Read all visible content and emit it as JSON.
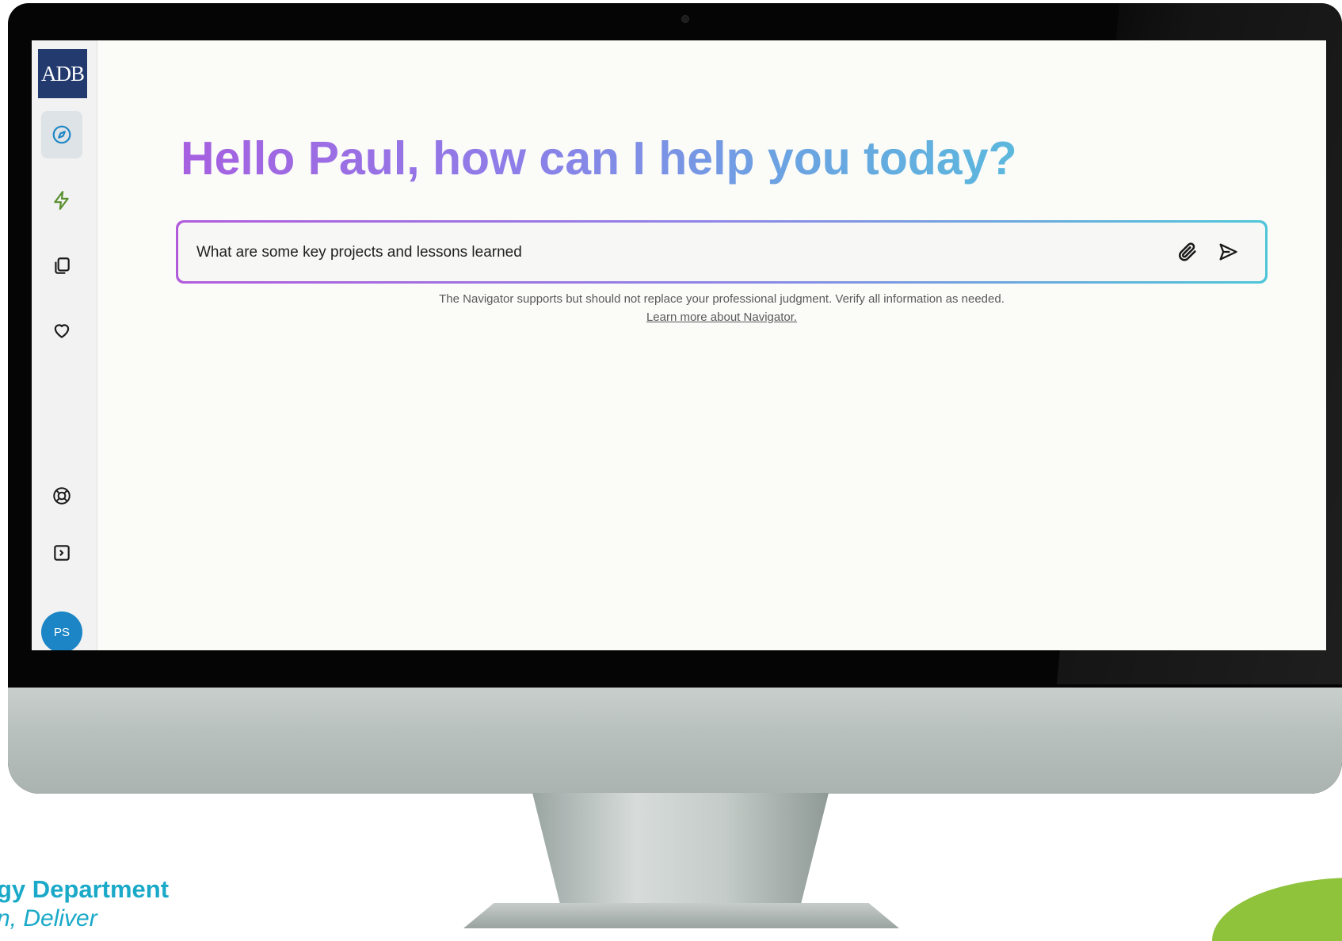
{
  "sidebar": {
    "logo": "ADB",
    "items": [
      {
        "name": "compass",
        "active": true
      },
      {
        "name": "lightning"
      },
      {
        "name": "documents"
      },
      {
        "name": "heart"
      },
      {
        "name": "help"
      },
      {
        "name": "expand-panel"
      }
    ],
    "avatar": "PS"
  },
  "main": {
    "greeting": "Hello Paul, how can I help you today?",
    "input": {
      "value": "What are some key projects and lessons learned"
    },
    "disclaimer": "The Navigator supports but should not replace your professional judgment. Verify all information as needed.",
    "learn_more": "Learn more about Navigator."
  },
  "footer": {
    "brand_line1": "gy Department",
    "brand_line2": "n, Deliver"
  },
  "colors": {
    "logo_bg": "#233a6e",
    "avatar_bg": "#1b85c6",
    "gradient_start": "#a660e0",
    "gradient_end": "#5cb8dd",
    "brand_text": "#1aa9c8",
    "brand_green": "#8fc33c"
  },
  "icons": [
    "compass-icon",
    "lightning-icon",
    "documents-icon",
    "heart-icon",
    "lifebuoy-icon",
    "sidebar-expand-icon",
    "paperclip-icon",
    "send-icon"
  ]
}
